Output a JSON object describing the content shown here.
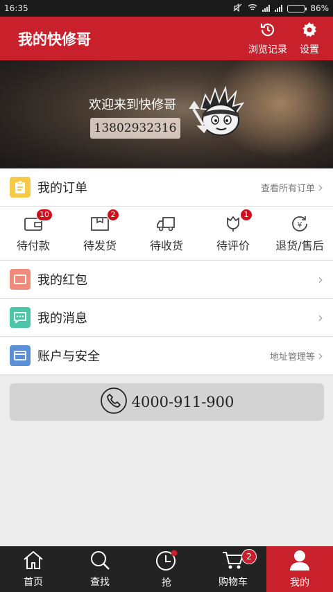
{
  "status_bar": {
    "time": "16:35",
    "battery": "86%",
    "battery_level": 0.86
  },
  "header": {
    "title": "我的快修哥",
    "history_label": "浏览记录",
    "settings_label": "设置"
  },
  "banner": {
    "welcome": "欢迎来到快修哥",
    "phone": "13802932316"
  },
  "my_orders": {
    "label": "我的订单",
    "hint": "查看所有订单"
  },
  "order_status": [
    {
      "label": "待付款",
      "badge": "10",
      "icon": "wallet-icon"
    },
    {
      "label": "待发货",
      "badge": "2",
      "icon": "package-icon"
    },
    {
      "label": "待收货",
      "badge": "",
      "icon": "truck-icon"
    },
    {
      "label": "待评价",
      "badge": "1",
      "icon": "flower-icon"
    },
    {
      "label": "退货/售后",
      "badge": "",
      "icon": "refund-icon"
    }
  ],
  "menu": {
    "red_packet": {
      "label": "我的红包",
      "hint": "",
      "color": "#f08a7a"
    },
    "messages": {
      "label": "我的消息",
      "hint": "",
      "color": "#4cc6a8"
    },
    "account": {
      "label": "账户与安全",
      "hint": "地址管理等",
      "color": "#5b8fd6"
    },
    "orders_color": "#f7c948"
  },
  "hotline": {
    "number": "4000-911-900"
  },
  "tabs": [
    {
      "label": "首页",
      "icon": "home-icon",
      "badge": ""
    },
    {
      "label": "查找",
      "icon": "search-icon",
      "badge": ""
    },
    {
      "label": "抢",
      "icon": "clock-icon",
      "badge": ""
    },
    {
      "label": "购物车",
      "icon": "cart-icon",
      "badge": "2"
    },
    {
      "label": "我的",
      "icon": "user-icon",
      "badge": ""
    }
  ],
  "colors": {
    "brand": "#c9212c",
    "badge": "#d0101c",
    "tabbar": "#232323"
  }
}
